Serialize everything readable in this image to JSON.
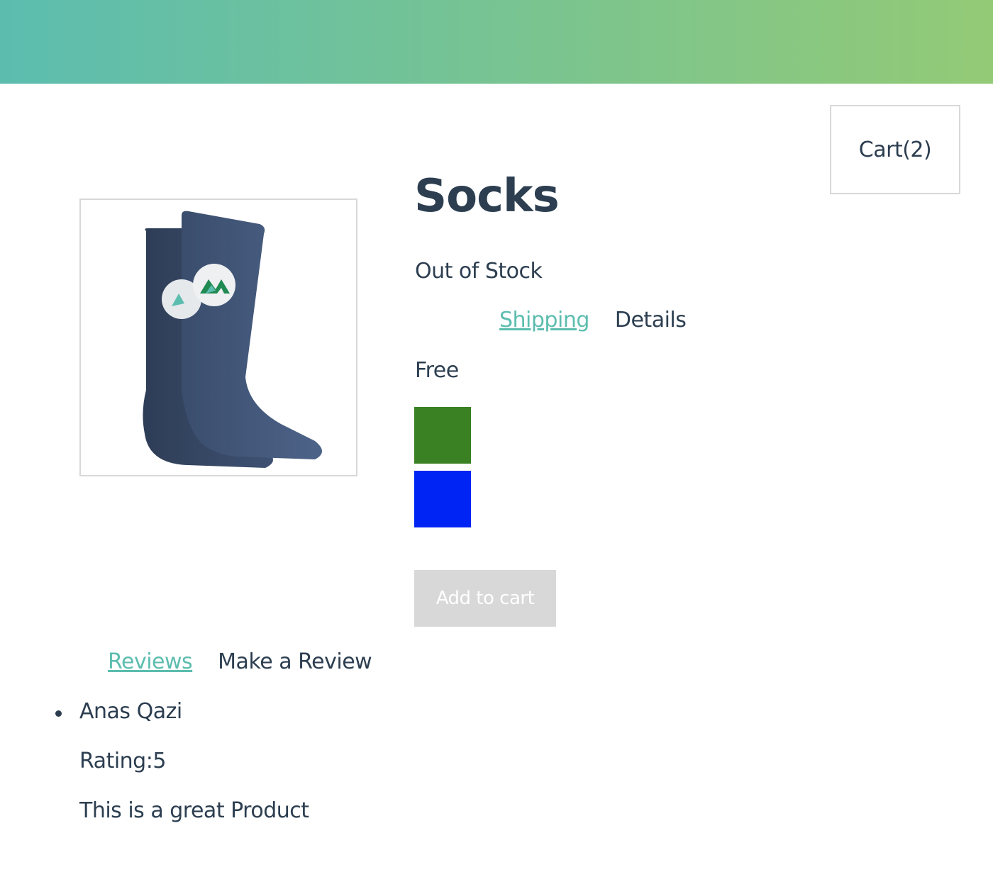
{
  "header": {
    "gradient_start": "#5cbdaf",
    "gradient_end": "#93ca76"
  },
  "cart": {
    "label": "Cart(2)"
  },
  "product": {
    "title": "Socks",
    "stock_status": "Out of Stock",
    "image_alt": "socks-image"
  },
  "info_tabs": {
    "shipping_label": "Shipping",
    "details_label": "Details"
  },
  "shipping": {
    "value": "Free"
  },
  "variants": [
    {
      "color": "#3a8124"
    },
    {
      "color": "#0024f4"
    }
  ],
  "add_to_cart": {
    "label": "Add to cart",
    "disabled": true
  },
  "review_tabs": {
    "reviews_label": "Reviews",
    "make_review_label": "Make a Review"
  },
  "reviews": [
    {
      "name": "Anas Qazi",
      "rating_text": "Rating:5",
      "text": "This is a great Product"
    }
  ]
}
